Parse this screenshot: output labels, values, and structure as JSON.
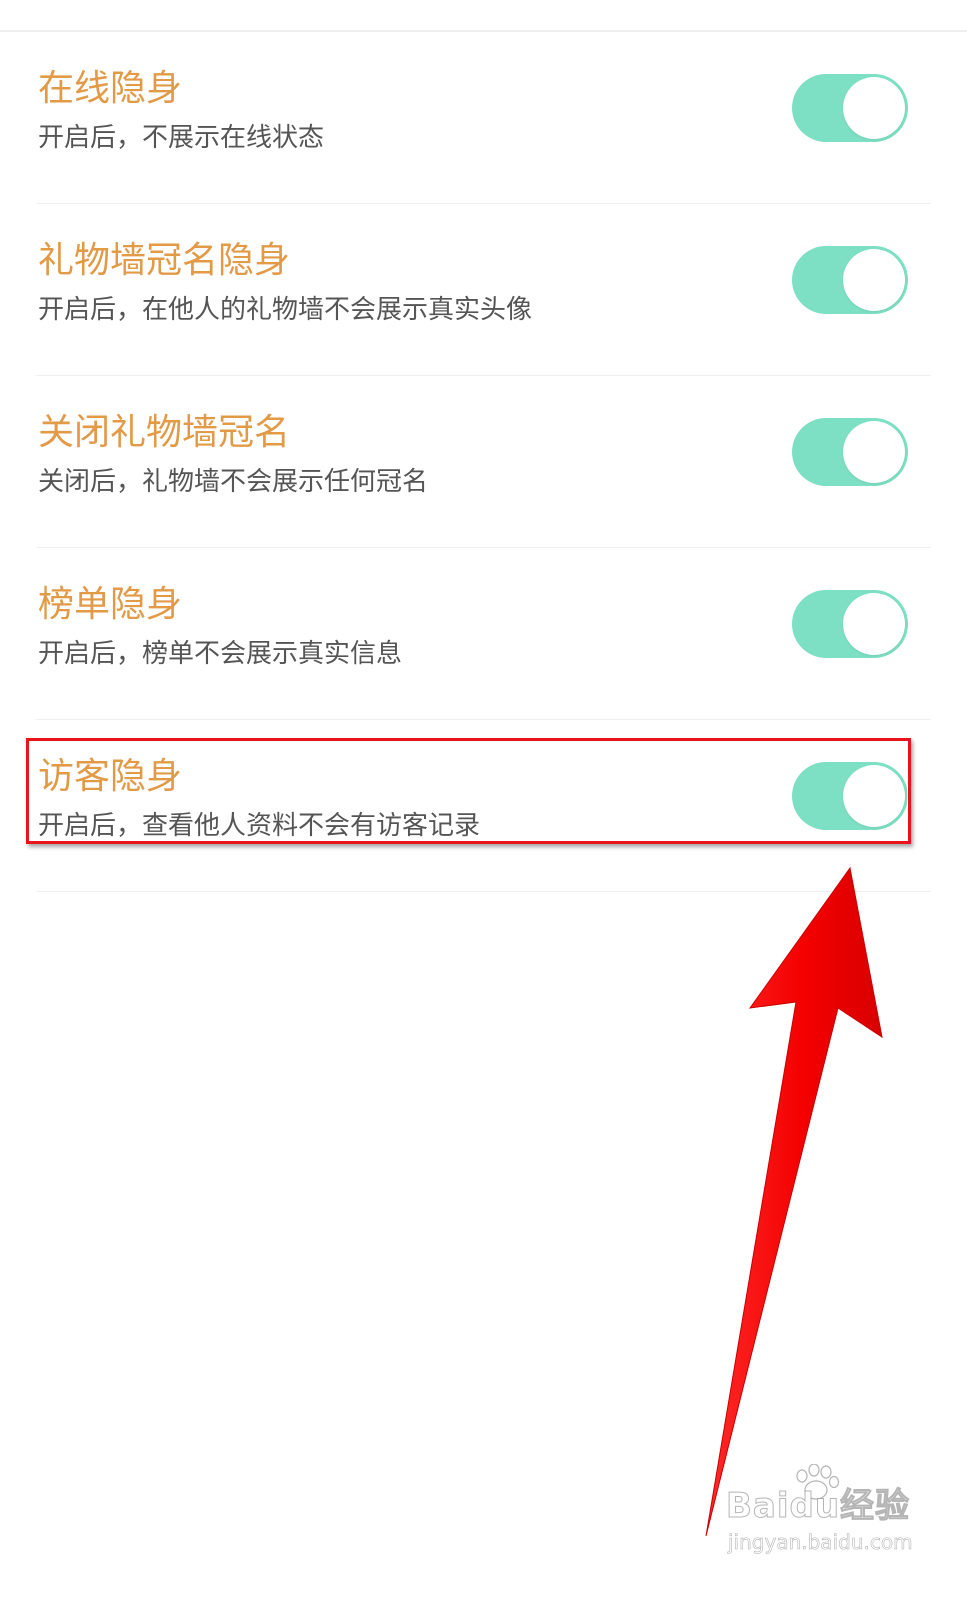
{
  "settings": [
    {
      "title": "在线隐身",
      "description": "开启后，不展示在线状态",
      "enabled": true
    },
    {
      "title": "礼物墙冠名隐身",
      "description": "开启后，在他人的礼物墙不会展示真实头像",
      "enabled": true
    },
    {
      "title": "关闭礼物墙冠名",
      "description": "关闭后，礼物墙不会展示任何冠名",
      "enabled": true
    },
    {
      "title": "榜单隐身",
      "description": "开启后，榜单不会展示真实信息",
      "enabled": true
    },
    {
      "title": "访客隐身",
      "description": "开启后，查看他人资料不会有访客记录",
      "enabled": true
    }
  ],
  "watermark": {
    "logo": "Baidu经验",
    "url": "jingyan.baidu.com"
  },
  "colors": {
    "title": "#e29a47",
    "description": "#555555",
    "toggle_on": "#7ddfc3",
    "highlight": "#e8141b",
    "arrow": "#ff0000"
  },
  "icons": {
    "annotation_arrow": "red-arrow-icon",
    "watermark_paw": "baidu-paw-icon"
  }
}
